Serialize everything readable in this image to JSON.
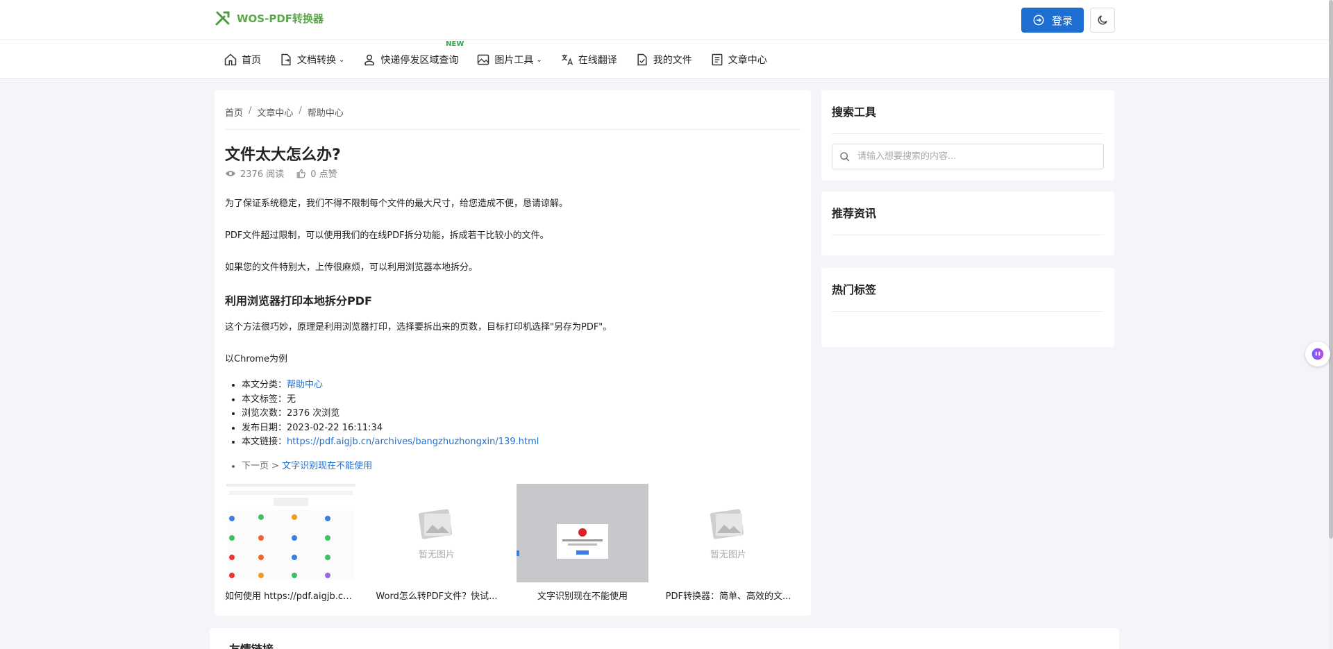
{
  "header": {
    "logo_text": "WOS-PDF转换器",
    "login_label": "登录"
  },
  "nav": {
    "items": [
      {
        "label": "首页"
      },
      {
        "label": "文档转换",
        "caret": "⌄"
      },
      {
        "label": "快递停发区域查询",
        "badge": "NEW"
      },
      {
        "label": "图片工具",
        "caret": "⌄"
      },
      {
        "label": "在线翻译"
      },
      {
        "label": "我的文件"
      },
      {
        "label": "文章中心"
      }
    ]
  },
  "breadcrumb": {
    "items": [
      "首页",
      "文章中心",
      "帮助中心"
    ],
    "sep": "/"
  },
  "article": {
    "title": "文件太大怎么办?",
    "reads": "2376 阅读",
    "likes": "0 点赞",
    "p1": "为了保证系统稳定，我们不得不限制每个文件的最大尺寸，给您造成不便，恳请谅解。",
    "p2": "PDF文件超过限制，可以使用我们的在线PDF拆分功能，拆成若干比较小的文件。",
    "p3": "如果您的文件特别大，上传很麻烦，可以利用浏览器本地拆分。",
    "h2": "利用浏览器打印本地拆分PDF",
    "p4": "这个方法很巧妙，原理是利用浏览器打印，选择要拆出来的页数，目标打印机选择\"另存为PDF\"。",
    "p5": "以Chrome为例"
  },
  "info": {
    "category_label": "本文分类：",
    "category_value": "帮助中心",
    "tags_label": "本文标签：",
    "tags_value": "无",
    "views_label": "浏览次数：",
    "views_value": "2376 次浏览",
    "date_label": "发布日期：",
    "date_value": "2023-02-22 16:11:34",
    "link_label": "本文链接：",
    "link_value": "https://pdf.aigjb.cn/archives/bangzhuzhongxin/139.html"
  },
  "next": {
    "label": "下一页 >",
    "link": "文字识别现在不能使用"
  },
  "related": {
    "no_image_text": "暂无图片",
    "items": [
      {
        "caption": "如何使用 https://pdf.aigjb.cn..."
      },
      {
        "caption": "Word怎么转PDF文件？快试..."
      },
      {
        "caption": "文字识别现在不能使用"
      },
      {
        "caption": "PDF转换器：简单、高效的文..."
      }
    ]
  },
  "sidebar": {
    "search_title": "搜索工具",
    "search_placeholder": "请输入想要搜索的内容...",
    "recommend_title": "推荐资讯",
    "tags_title": "热门标签"
  },
  "footer": {
    "friend_links_title": "友情链接"
  },
  "colors": {
    "brand": "#1f6fd3",
    "logo_green": "#5aa84a"
  }
}
